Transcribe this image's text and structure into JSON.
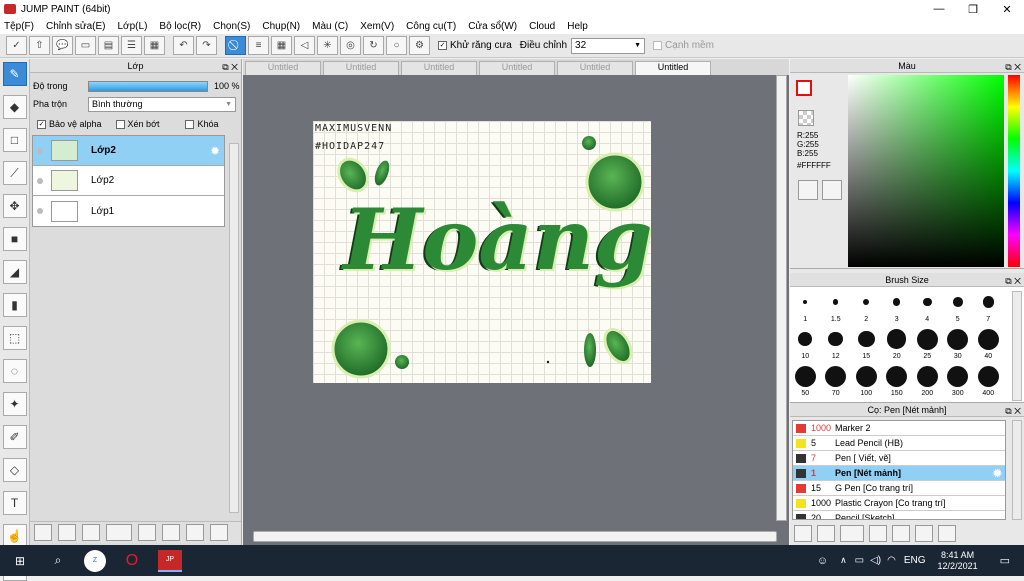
{
  "window": {
    "title": "JUMP PAINT (64bit)"
  },
  "menu": [
    "Tệp(F)",
    "Chỉnh sửa(E)",
    "Lớp(L)",
    "Bộ lọc(R)",
    "Chọn(S)",
    "Chụp(N)",
    "Màu (C)",
    "Xem(V)",
    "Công cụ(T)",
    "Cửa sổ(W)",
    "Cloud",
    "Help"
  ],
  "toolbar": {
    "antialias_label": "Khử răng cưa",
    "adjust_label": "Điều chỉnh",
    "adjust_value": "32",
    "smooth_label": "Cạnh mềm"
  },
  "layer_panel": {
    "title": "Lớp",
    "opacity_label": "Độ trong",
    "opacity_value": "100 %",
    "opacity_fraction": 1.0,
    "blend_label": "Pha trộn",
    "blend_value": "Bình thường",
    "protect_alpha": "Bảo vệ alpha",
    "clip": "Xén bớt",
    "lock": "Khóa",
    "layers": [
      {
        "name": "Lớp2",
        "selected": true
      },
      {
        "name": "Lớp2",
        "selected": false
      },
      {
        "name": "Lớp1",
        "selected": false
      }
    ]
  },
  "tabs": [
    "Untitled",
    "Untitled",
    "Untitled",
    "Untitled",
    "Untitled",
    "Untitled"
  ],
  "canvas": {
    "line1": "MAXIMUSVENN",
    "line2": "#HOIDAP247",
    "word": "Hoàng"
  },
  "color_panel": {
    "title": "Màu",
    "r": "R:255",
    "g": "G:255",
    "b": "B:255",
    "hex": "#FFFFFF"
  },
  "brush_size": {
    "title": "Brush Size",
    "sizes": [
      "1",
      "1.5",
      "2",
      "3",
      "4",
      "5",
      "7",
      "10",
      "12",
      "15",
      "20",
      "25",
      "30",
      "40",
      "50",
      "70",
      "100",
      "150",
      "200",
      "300",
      "400"
    ]
  },
  "brush_list": {
    "title": "Cọ: Pen [Nét mảnh]",
    "items": [
      {
        "size": "1000",
        "name": "Marker 2",
        "color": "#e53935",
        "selected": false,
        "size_red": true
      },
      {
        "size": "5",
        "name": "Lead Pencil (HB)",
        "color": "#f3e21c",
        "selected": false,
        "size_red": false
      },
      {
        "size": "7",
        "name": "Pen [ Viết, vẽ]",
        "color": "#333333",
        "selected": false,
        "size_red": true
      },
      {
        "size": "1",
        "name": "Pen [Nét mảnh]",
        "color": "#333333",
        "selected": true,
        "size_red": true
      },
      {
        "size": "15",
        "name": "G Pen [Co trang trí]",
        "color": "#e53935",
        "selected": false,
        "size_red": false
      },
      {
        "size": "1000",
        "name": "Plastic Crayon [Co trang trí]",
        "color": "#f3e21c",
        "selected": false,
        "size_red": false
      },
      {
        "size": "20",
        "name": "Pencil [Sketch]",
        "color": "#333333",
        "selected": false,
        "size_red": false
      }
    ]
  },
  "taskbar": {
    "time": "8:41 AM",
    "date": "12/2/2021",
    "lang": "ENG"
  }
}
